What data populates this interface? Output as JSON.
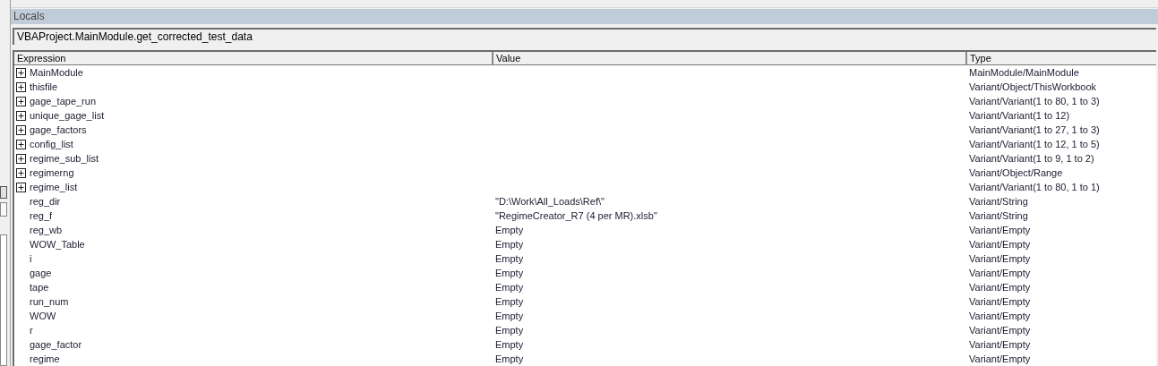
{
  "panel": {
    "title": "Locals"
  },
  "context": "VBAProject.MainModule.get_corrected_test_data",
  "table": {
    "columns": [
      "Expression",
      "Value",
      "Type"
    ],
    "rows": [
      {
        "kind": "expandable",
        "expression": "MainModule",
        "value": "",
        "type": "MainModule/MainModule"
      },
      {
        "kind": "expandable",
        "expression": "thisfile",
        "value": "",
        "type": "Variant/Object/ThisWorkbook"
      },
      {
        "kind": "expandable",
        "expression": "gage_tape_run",
        "value": "",
        "type": "Variant/Variant(1 to 80, 1 to 3)"
      },
      {
        "kind": "expandable",
        "expression": "unique_gage_list",
        "value": "",
        "type": "Variant/Variant(1 to 12)"
      },
      {
        "kind": "expandable",
        "expression": "gage_factors",
        "value": "",
        "type": "Variant/Variant(1 to 27, 1 to 3)"
      },
      {
        "kind": "expandable",
        "expression": "config_list",
        "value": "",
        "type": "Variant/Variant(1 to 12, 1 to 5)"
      },
      {
        "kind": "expandable",
        "expression": "regime_sub_list",
        "value": "",
        "type": "Variant/Variant(1 to 9, 1 to 2)"
      },
      {
        "kind": "expandable",
        "expression": "regimerng",
        "value": "",
        "type": "Variant/Object/Range"
      },
      {
        "kind": "expandable",
        "expression": "regime_list",
        "value": "",
        "type": "Variant/Variant(1 to 80, 1 to 1)"
      },
      {
        "kind": "leaf",
        "expression": "reg_dir",
        "value": "\"D:\\Work\\All_Loads\\Ref\\\"",
        "type": "Variant/String"
      },
      {
        "kind": "leaf",
        "expression": "reg_f",
        "value": "\"RegimeCreator_R7 (4 per MR).xlsb\"",
        "type": "Variant/String"
      },
      {
        "kind": "leaf",
        "expression": "reg_wb",
        "value": "Empty",
        "type": "Variant/Empty"
      },
      {
        "kind": "leaf",
        "expression": "WOW_Table",
        "value": "Empty",
        "type": "Variant/Empty"
      },
      {
        "kind": "leaf",
        "expression": "i",
        "value": "Empty",
        "type": "Variant/Empty"
      },
      {
        "kind": "leaf",
        "expression": "gage",
        "value": "Empty",
        "type": "Variant/Empty"
      },
      {
        "kind": "leaf",
        "expression": "tape",
        "value": "Empty",
        "type": "Variant/Empty"
      },
      {
        "kind": "leaf",
        "expression": "run_num",
        "value": "Empty",
        "type": "Variant/Empty"
      },
      {
        "kind": "leaf",
        "expression": "WOW",
        "value": "Empty",
        "type": "Variant/Empty"
      },
      {
        "kind": "leaf",
        "expression": "r",
        "value": "Empty",
        "type": "Variant/Empty"
      },
      {
        "kind": "leaf",
        "expression": "gage_factor",
        "value": "Empty",
        "type": "Variant/Empty"
      },
      {
        "kind": "leaf",
        "expression": "regime",
        "value": "Empty",
        "type": "Variant/Empty"
      }
    ]
  }
}
